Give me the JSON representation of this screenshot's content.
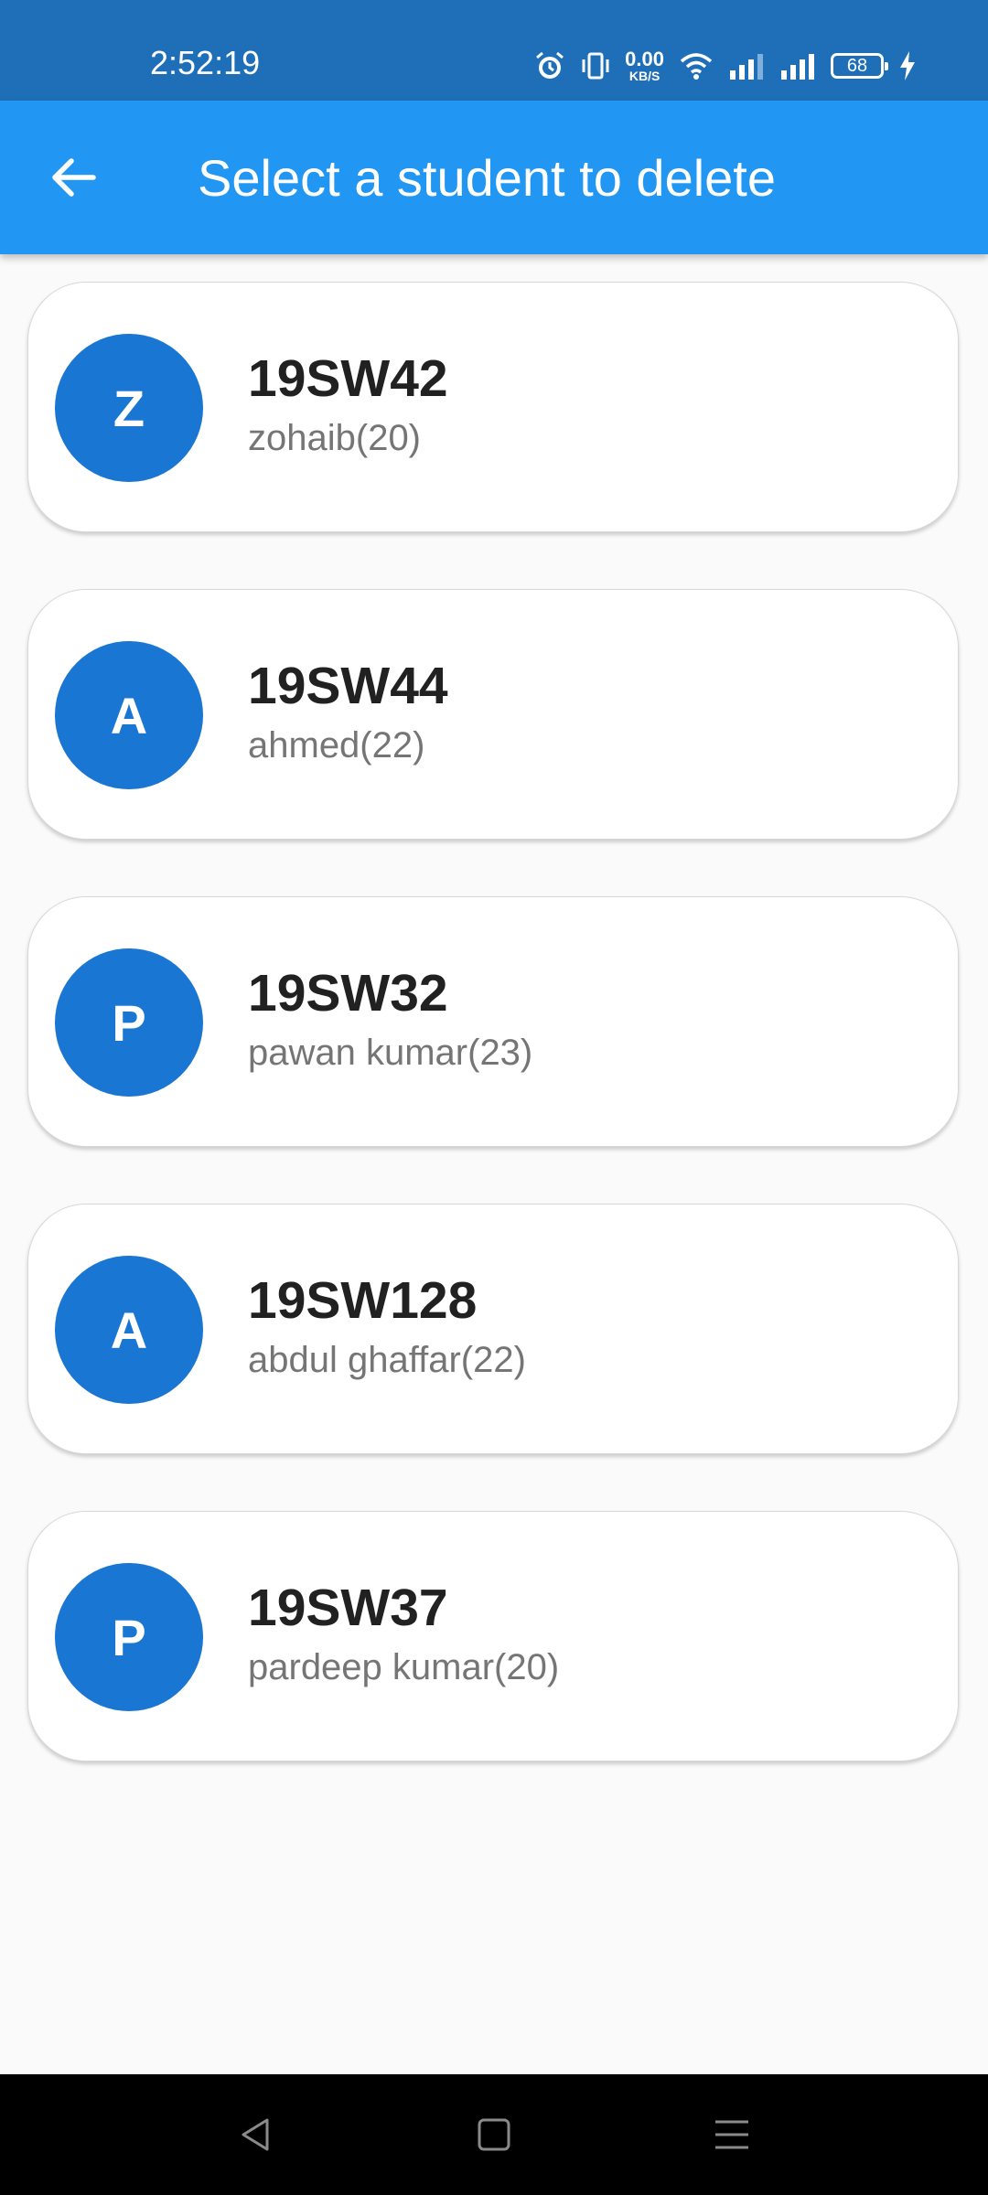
{
  "status_bar": {
    "time": "2:52:19",
    "net_speed": "0.00",
    "net_unit": "KB/S",
    "battery": "68",
    "icons": [
      "alarm-icon",
      "vibrate-icon",
      "wifi-icon",
      "signal-icon",
      "signal-icon",
      "battery-icon",
      "charging-icon"
    ]
  },
  "app_bar": {
    "title": "Select a student to delete",
    "back_icon": "arrow-back-icon",
    "color": "#2196f3"
  },
  "students": [
    {
      "initial": "Z",
      "roll": "19SW42",
      "name": "zohaib(20)"
    },
    {
      "initial": "A",
      "roll": "19SW44",
      "name": "ahmed(22)"
    },
    {
      "initial": "P",
      "roll": "19SW32",
      "name": "pawan kumar(23)"
    },
    {
      "initial": "A",
      "roll": "19SW128",
      "name": "abdul ghaffar(22)"
    },
    {
      "initial": "P",
      "roll": "19SW37",
      "name": "pardeep kumar(20)"
    }
  ],
  "nav_bar": {
    "icons": [
      "back-triangle-icon",
      "home-square-icon",
      "menu-lines-icon"
    ]
  },
  "colors": {
    "status_bar": "#1e6fb8",
    "avatar": "#1976d2",
    "background": "#fafafa"
  }
}
